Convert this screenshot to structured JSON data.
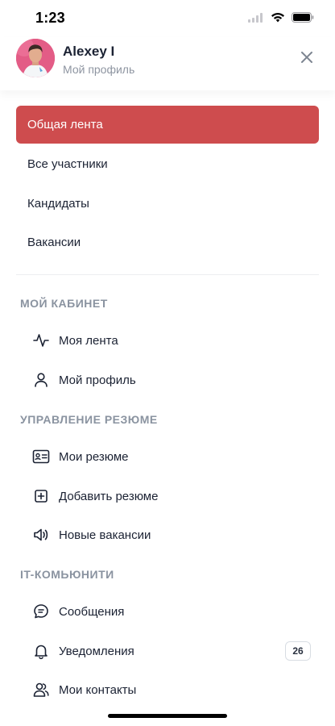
{
  "status_bar": {
    "time": "1:23"
  },
  "header": {
    "user_name": "Alexey I",
    "user_subtitle": "Мой профиль"
  },
  "main_nav": [
    {
      "label": "Общая лента",
      "active": true
    },
    {
      "label": "Все участники",
      "active": false
    },
    {
      "label": "Кандидаты",
      "active": false
    },
    {
      "label": "Вакансии",
      "active": false
    }
  ],
  "sections": {
    "cabinet": {
      "title": "МОЙ КАБИНЕТ",
      "items": [
        {
          "label": "Моя лента",
          "icon": "activity-icon"
        },
        {
          "label": "Мой профиль",
          "icon": "user-icon"
        }
      ]
    },
    "resume": {
      "title": "УПРАВЛЕНИЕ РЕЗЮМЕ",
      "items": [
        {
          "label": "Мои резюме",
          "icon": "id-card-icon"
        },
        {
          "label": "Добавить резюме",
          "icon": "plus-square-icon"
        },
        {
          "label": "Новые вакансии",
          "icon": "megaphone-icon"
        }
      ]
    },
    "community": {
      "title": "IT-КОМЬЮНИТИ",
      "items": [
        {
          "label": "Сообщения",
          "icon": "message-icon"
        },
        {
          "label": "Уведомления",
          "icon": "bell-icon",
          "badge": "26"
        },
        {
          "label": "Мои контакты",
          "icon": "users-icon"
        }
      ]
    }
  },
  "colors": {
    "accent": "#ce4c4e",
    "section_title": "#8a93a0",
    "text": "#1b2233"
  }
}
